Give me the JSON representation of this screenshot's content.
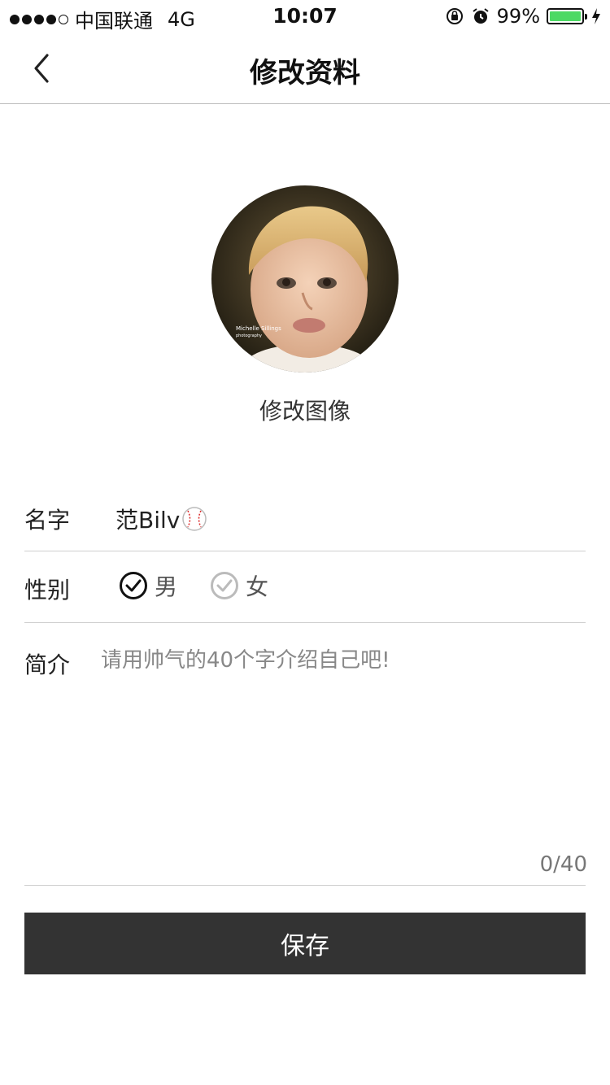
{
  "status_bar": {
    "carrier": "中国联通",
    "network": "4G",
    "time": "10:07",
    "battery_text": "99%",
    "battery_level": 0.99,
    "battery_color": "#4cd964",
    "icons": [
      "orientation-lock-icon",
      "alarm-icon",
      "charging-bolt-icon"
    ]
  },
  "nav": {
    "title": "修改资料",
    "back_icon": "chevron-left-icon"
  },
  "avatar": {
    "label": "修改图像",
    "watermark": "Michelle Sillings photography"
  },
  "form": {
    "name": {
      "label": "名字",
      "value": "范Bilv",
      "emoji_icon": "baseball-icon"
    },
    "gender": {
      "label": "性别",
      "options": [
        {
          "label": "男",
          "selected": true
        },
        {
          "label": "女",
          "selected": false
        }
      ]
    },
    "bio": {
      "label": "简介",
      "placeholder": "请用帅气的40个字介绍自己吧!",
      "value": "",
      "counter": "0/40"
    }
  },
  "save_button": {
    "label": "保存"
  },
  "colors": {
    "primary_button": "#333333",
    "divider": "#cfcfcf",
    "check_selected": "#111111",
    "check_unselected": "#bbbbbb"
  }
}
